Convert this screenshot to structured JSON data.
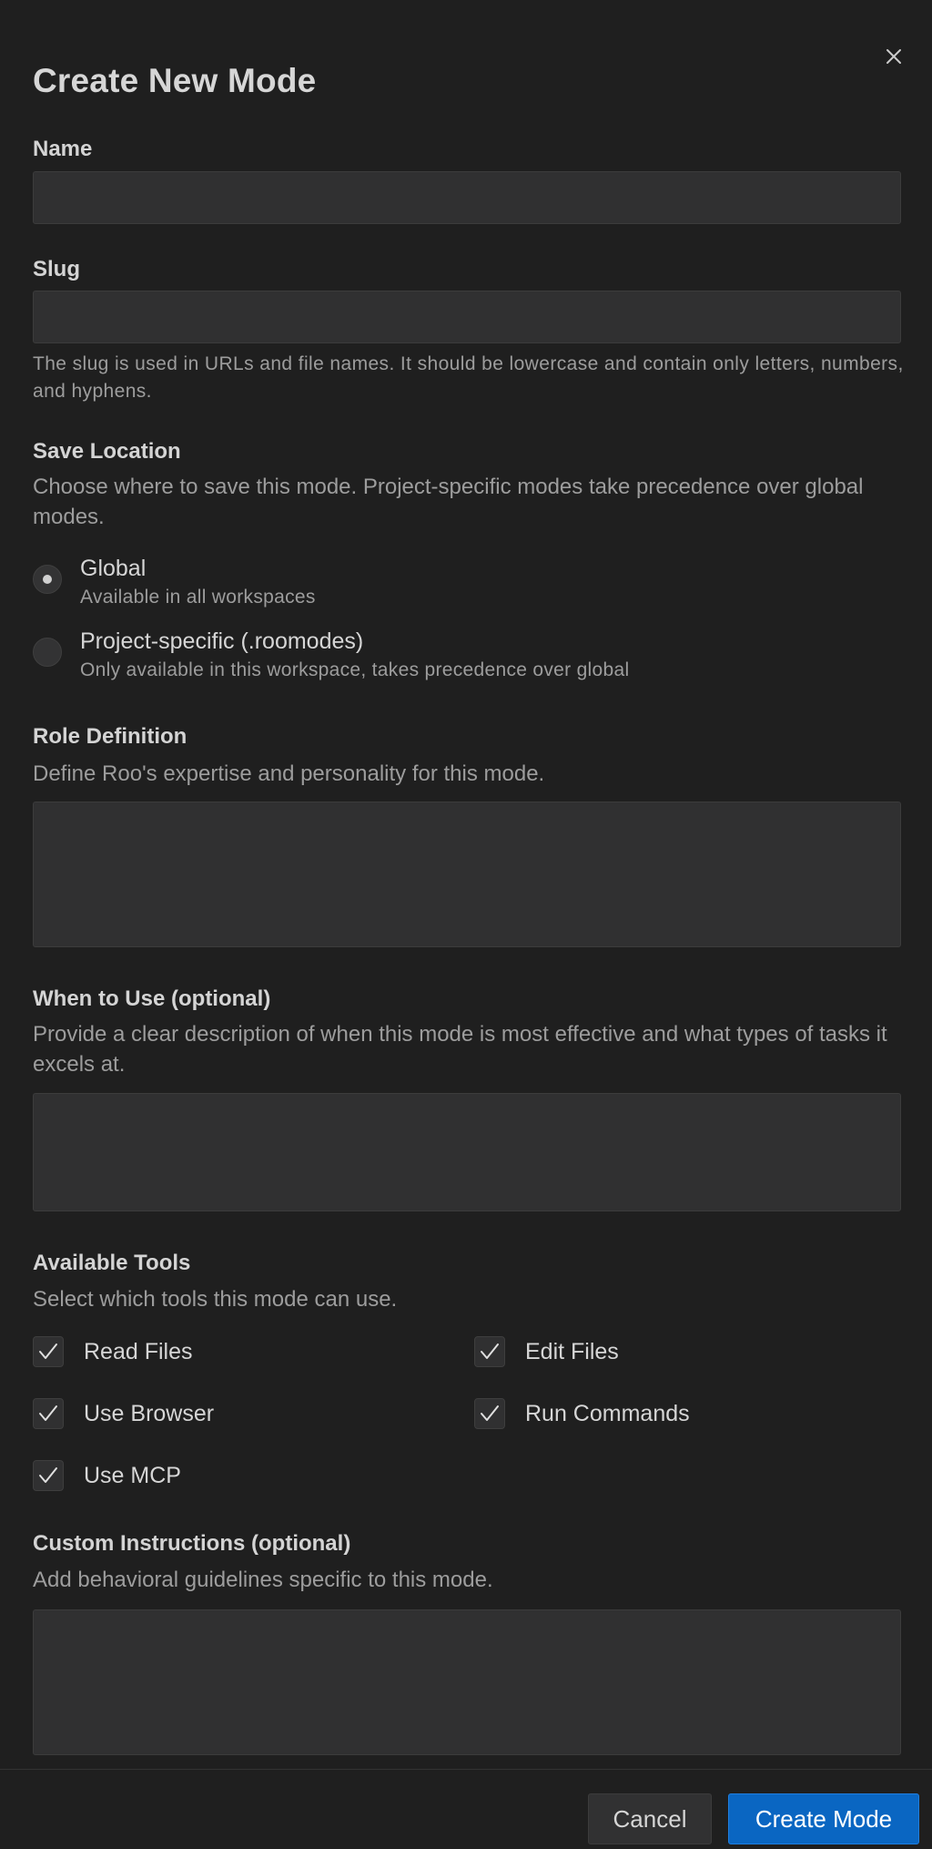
{
  "dialog": {
    "title": "Create New Mode",
    "close_icon": "close-icon"
  },
  "name": {
    "label": "Name",
    "value": "",
    "placeholder": ""
  },
  "slug": {
    "label": "Slug",
    "value": "",
    "placeholder": "",
    "help": "The slug is used in URLs and file names. It should be lowercase and contain only letters, numbers, and hyphens."
  },
  "save_location": {
    "label": "Save Location",
    "description": "Choose where to save this mode. Project-specific modes take precedence over global modes.",
    "options": [
      {
        "title": "Global",
        "subtitle": "Available in all workspaces",
        "selected": true
      },
      {
        "title": "Project-specific (.roomodes)",
        "subtitle": "Only available in this workspace, takes precedence over global",
        "selected": false
      }
    ]
  },
  "role_definition": {
    "label": "Role Definition",
    "description": "Define Roo's expertise and personality for this mode.",
    "value": ""
  },
  "when_to_use": {
    "label": "When to Use (optional)",
    "description": "Provide a clear description of when this mode is most effective and what types of tasks it excels at.",
    "value": ""
  },
  "tools": {
    "label": "Available Tools",
    "description": "Select which tools this mode can use.",
    "items": [
      {
        "label": "Read Files",
        "checked": true
      },
      {
        "label": "Edit Files",
        "checked": true
      },
      {
        "label": "Use Browser",
        "checked": true
      },
      {
        "label": "Run Commands",
        "checked": true
      },
      {
        "label": "Use MCP",
        "checked": true
      }
    ]
  },
  "custom_instructions": {
    "label": "Custom Instructions (optional)",
    "description": "Add behavioral guidelines specific to this mode.",
    "value": ""
  },
  "footer": {
    "cancel_label": "Cancel",
    "create_label": "Create Mode"
  },
  "colors": {
    "background": "#1f1f1f",
    "input_background": "#303031",
    "primary_button": "#0a66c2"
  }
}
